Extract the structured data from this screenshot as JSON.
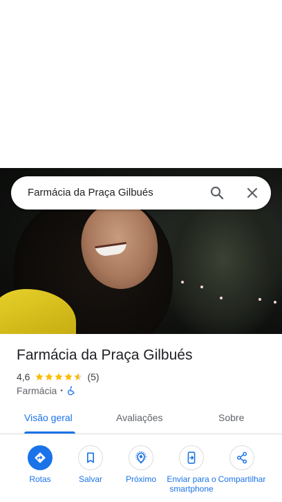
{
  "search": {
    "query": "Farmácia da Praça Gilbués"
  },
  "place": {
    "title": "Farmácia da Praça Gilbués",
    "rating": "4,6",
    "rating_stars": 4.6,
    "review_count": "(5)",
    "category": "Farmácia",
    "separator": "•"
  },
  "tabs": [
    {
      "label": "Visão geral",
      "selected": true
    },
    {
      "label": "Avaliações",
      "selected": false
    },
    {
      "label": "Sobre",
      "selected": false
    }
  ],
  "actions": [
    {
      "label": "Rotas",
      "icon": "directions-icon"
    },
    {
      "label": "Salvar",
      "icon": "bookmark-icon"
    },
    {
      "label": "Próximo",
      "icon": "nearby-icon"
    },
    {
      "label": "Enviar para o smartphone",
      "icon": "send-to-phone-icon"
    },
    {
      "label": "Compartilhar",
      "icon": "share-icon"
    }
  ],
  "colors": {
    "accent": "#1a73e8",
    "star": "#fbbc04",
    "text": "#202124",
    "secondary": "#5f6368"
  }
}
